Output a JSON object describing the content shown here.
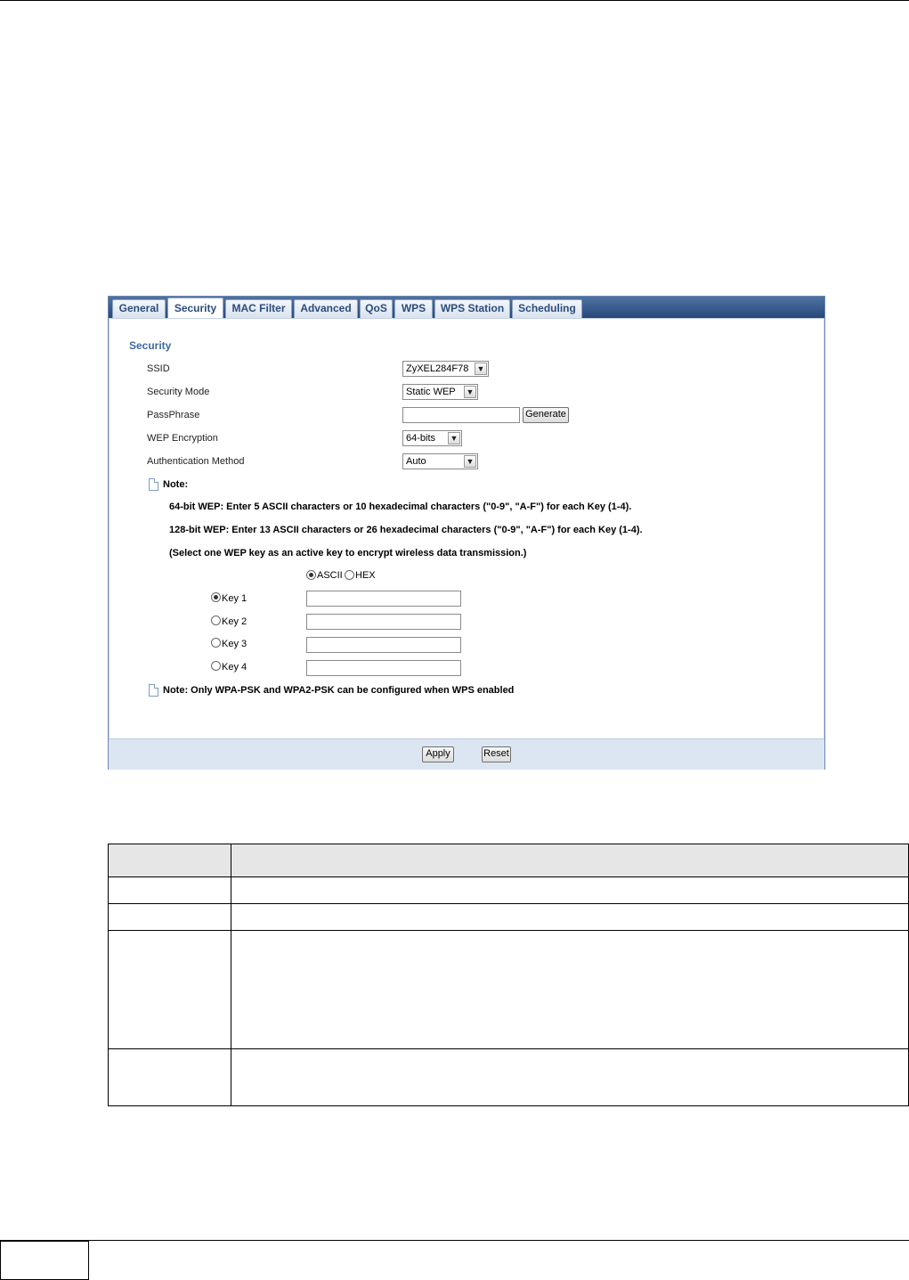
{
  "tabs": [
    "General",
    "Security",
    "MAC Filter",
    "Advanced",
    "QoS",
    "WPS",
    "WPS Station",
    "Scheduling"
  ],
  "active_tab": "Security",
  "section_title": "Security",
  "fields": {
    "ssid_label": "SSID",
    "ssid_value": "ZyXEL284F78",
    "security_mode_label": "Security Mode",
    "security_mode_value": "Static WEP",
    "passphrase_label": "PassPhrase",
    "passphrase_value": "",
    "generate_label": "Generate",
    "wep_encryption_label": "WEP Encryption",
    "wep_encryption_value": "64-bits",
    "auth_method_label": "Authentication Method",
    "auth_method_value": "Auto"
  },
  "note": {
    "title": "Note:",
    "line1": "64-bit WEP: Enter 5 ASCII characters or 10 hexadecimal characters (\"0-9\", \"A-F\") for each Key (1-4).",
    "line2": "128-bit WEP: Enter 13 ASCII characters or 26 hexadecimal characters (\"0-9\", \"A-F\") for each Key (1-4).",
    "line3": "(Select one WEP key as an active key to encrypt wireless data transmission.)"
  },
  "key_format": {
    "ascii": "ASCII",
    "hex": "HEX",
    "selected": "ASCII"
  },
  "keys": [
    {
      "label": "Key 1",
      "selected": true,
      "value": ""
    },
    {
      "label": "Key 2",
      "selected": false,
      "value": ""
    },
    {
      "label": "Key 3",
      "selected": false,
      "value": ""
    },
    {
      "label": "Key 4",
      "selected": false,
      "value": ""
    }
  ],
  "wps_note": "Note: Only WPA-PSK and WPA2-PSK can be configured when WPS enabled",
  "buttons": {
    "apply": "Apply",
    "reset": "Reset"
  },
  "colors": {
    "tabbar": "#26497a",
    "section_title": "#3d6aa3",
    "footer": "#dce6f2"
  }
}
